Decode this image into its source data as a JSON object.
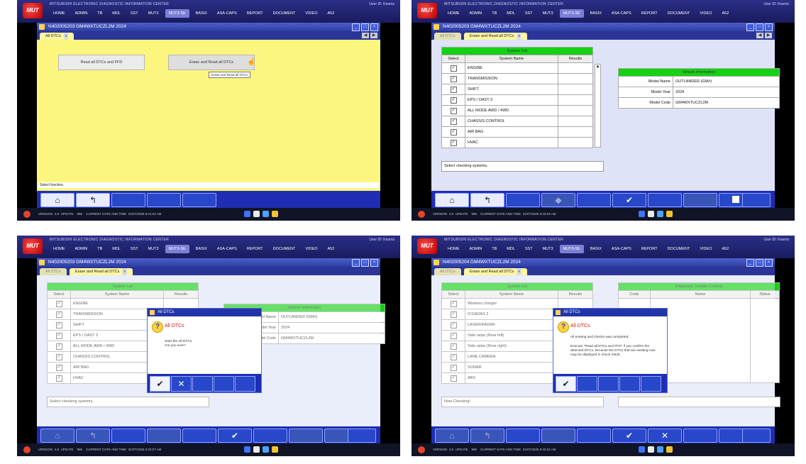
{
  "menu": {
    "title": "MITSUBISHI  ELECTRONIC  DIAGNOSTIC  INFORMATION  CENTER",
    "user_info": "User ID:   Kearns",
    "tabs": [
      "HOME",
      "ADMIN",
      "TB",
      "MDL",
      "SST",
      "MUT3",
      "MUT3-SE",
      "BASIX",
      "ASA-CAPS",
      "REPORT",
      "DOCUMENT",
      "VIDEO",
      "A52"
    ],
    "active_tab": "MUT3-SE",
    "logo": "MUT"
  },
  "taskbar": {
    "version_label": "VERSION",
    "version": "4.8",
    "update": "UPDATE",
    "ns": "996",
    "datetime_label": "CURRENT DATE AND TIME",
    "datetime_1": "01/07/2025 9:41:04 AM",
    "datetime_2": "01/07/2025 9:42:03 AM",
    "datetime_3": "01/07/2025 9:42:07 AM",
    "datetime_4": "01/07/2025 9:42:24 AM"
  },
  "panel1": {
    "window_title": "N402005203  GM4WXTUCZL2M 2024",
    "tab": "All DTCs",
    "btn_read": "Read all DTCs and FFD",
    "btn_erase": "Erase and Read all DTCs",
    "tooltip": "Erase and Read all DTCs",
    "status": "Select function."
  },
  "panel2": {
    "window_title": "N402005203  GM4WXTUCZL2M 2024",
    "tab_all": "All DTCs",
    "tab_erase": "Erase and Read all DTCs",
    "system_list_header": "System List",
    "col_select": "Select",
    "col_system": "System Name",
    "col_results": "Results",
    "systems": [
      "ENGINE",
      "TRANSMISSION",
      "SHIFT",
      "EPS / OAST 3",
      "ALL MODE AWD / 4WD",
      "CHASSIS CONTROL",
      "AIR BAG",
      "HVAC"
    ],
    "vehicle_info_header": "Vehicle Information",
    "info_labels": [
      "Model Name",
      "Model Year",
      "Model Code"
    ],
    "info_values": [
      "OUTLANDER (GM/r)",
      "2024",
      "GM4WXTUCZL2M"
    ],
    "hint": "Select checking systems."
  },
  "panel3": {
    "window_title": "N402005203  GM4WXTUCZL2M 2024",
    "dialog_title": "All DTCs",
    "dialog_heading": "All DTCs",
    "dialog_msg_1": "Start the All DTCs.",
    "dialog_msg_2": "Are you sure?",
    "info_values": [
      "OUTLANDER (GM/r)",
      "2024",
      "GM4WXTUCZL2M"
    ],
    "hint": "Select checking systems."
  },
  "panel4": {
    "window_title": "N402005204  GM4WXTUCZL2M 2024",
    "systems": [
      "Wireless charger",
      "ICGADAS 2",
      "LASER/RADAR",
      "Side radar (Rear left)",
      "Side radar (Rear right)",
      "LANE CAMERA",
      "SONAR",
      "ABS"
    ],
    "dtc_list_header": "Diagnostic Trouble Code(s)",
    "col_code": "Code",
    "col_name": "Name",
    "col_status": "Status",
    "dialog_title": "All DTCs",
    "dialog_heading": "All DTCs",
    "dialog_msg_1": "All erasing and checks was completed.",
    "dialog_msg_2": "Execute \"Read all DTCs and FFD\" if you confirm the detected DTCs, because the DTCs that are existing now may be displayed in check result.",
    "status": "Now Checking!"
  },
  "colors": {
    "menu": "#1d2070",
    "yellow": "#fdf67e",
    "green_header": "#16d016",
    "key_blue": "#2847c9"
  }
}
